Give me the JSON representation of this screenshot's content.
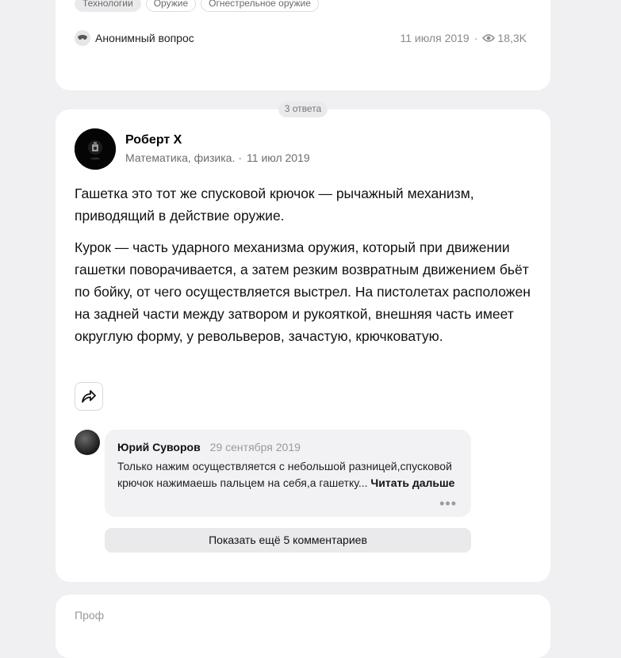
{
  "question": {
    "tags": [
      "Технологии",
      "Оружие",
      "Огнестрельное оружие"
    ],
    "author_label": "Анонимный вопрос",
    "date": "11 июля 2019",
    "separator": "·",
    "views": "18,3K"
  },
  "answers_count": "3 ответа",
  "answer": {
    "author_name": "Роберт Х",
    "author_bio": "Математика, физика.",
    "separator": "·",
    "date": "11 июл 2019",
    "paragraphs": [
      "Гашетка это тот же спусковой крючок — рычажный механизм, приводящий в действие оружие.",
      "Курок — часть ударного механизма оружия, который при движении гашетки поворачивается, а затем резким возвратным движением бьёт по бойку, от чего осуществляется выстрел. На пистолетах расположен на задней части между затвором и рукояткой, внешняя часть имеет округлую форму, у револьверов, зачастую, крючковатую."
    ]
  },
  "comment": {
    "author": "Юрий Суворов",
    "date": "29 сентября 2019",
    "text": "Только нажим осуществляется с небольшой разницей,спусковой крючок нажимаешь пальцем на себя,а гашетку...",
    "read_more": "Читать дальше",
    "more_label": "•••"
  },
  "show_more_label": "Показать ещё 5 комментариев",
  "next_card": {
    "author_partial": "Проф"
  }
}
